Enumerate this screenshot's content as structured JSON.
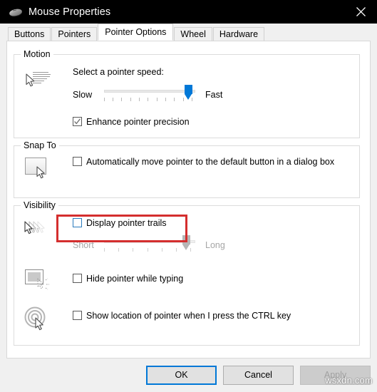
{
  "window": {
    "title": "Mouse Properties",
    "icon": "mouse-icon",
    "close_label": "✕"
  },
  "tabs": [
    {
      "label": "Buttons",
      "selected": false
    },
    {
      "label": "Pointers",
      "selected": false
    },
    {
      "label": "Pointer Options",
      "selected": true
    },
    {
      "label": "Wheel",
      "selected": false
    },
    {
      "label": "Hardware",
      "selected": false
    }
  ],
  "groups": {
    "motion": {
      "title": "Motion",
      "icon": "cursor-speed-icon",
      "prompt": "Select a pointer speed:",
      "slider": {
        "min_label": "Slow",
        "max_label": "Fast",
        "value_percent": 88,
        "tick_count": 11,
        "enabled": true
      },
      "checkbox": {
        "label": "Enhance pointer precision",
        "checked": true
      }
    },
    "snap_to": {
      "title": "Snap To",
      "icon": "default-button-cursor-icon",
      "checkbox": {
        "label": "Automatically move pointer to the default button in a dialog box",
        "checked": false
      }
    },
    "visibility": {
      "title": "Visibility",
      "rows": [
        {
          "icon": "pointer-trails-icon",
          "checkbox": {
            "label": "Display pointer trails",
            "checked": false,
            "focused": true
          },
          "slider": {
            "min_label": "Short",
            "max_label": "Long",
            "value_percent": 83,
            "tick_count": 7,
            "enabled": false
          }
        },
        {
          "icon": "hide-pointer-icon",
          "checkbox": {
            "label": "Hide pointer while typing",
            "checked": false
          }
        },
        {
          "icon": "ctrl-locate-icon",
          "checkbox": {
            "label": "Show location of pointer when I press the CTRL key",
            "checked": false
          }
        }
      ]
    }
  },
  "annotation": {
    "color": "#d42e2e",
    "target": "Display pointer trails"
  },
  "footer": {
    "ok": "OK",
    "cancel": "Cancel",
    "apply": "Apply",
    "apply_enabled": false
  },
  "watermark": "wsxdn.com",
  "colors": {
    "accent": "#0078d7",
    "titlebar": "#000000",
    "annotation": "#d42e2e",
    "disabled_text": "#a6a6a6"
  }
}
